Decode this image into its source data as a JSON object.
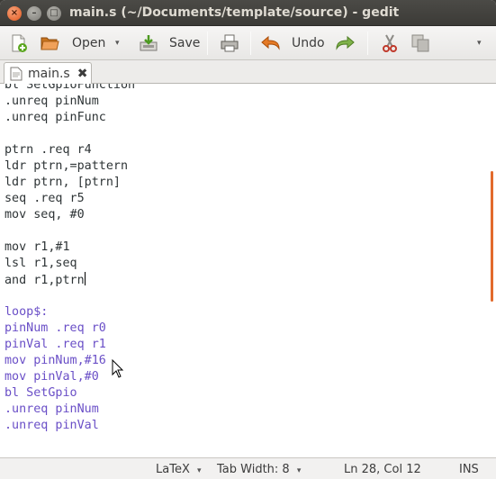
{
  "window": {
    "title": "main.s (~/Documents/template/source) - gedit",
    "close_glyph": "×",
    "min_glyph": "–",
    "max_glyph": "□"
  },
  "toolbar": {
    "new_icon": "new-document-icon",
    "open_label": "Open",
    "save_label": "Save",
    "print_icon": "print-icon",
    "undo_label": "Undo",
    "redo_icon": "redo-icon",
    "cut_icon": "cut-icon",
    "copy_icon": "copy-icon",
    "dropdown_glyph": "▾"
  },
  "tab": {
    "label": "main.s",
    "close_glyph": "✖"
  },
  "editor": {
    "lines": [
      {
        "text": "bl SetGpioFunction",
        "color": "black"
      },
      {
        "text": ".unreq pinNum",
        "color": "black"
      },
      {
        "text": ".unreq pinFunc",
        "color": "black"
      },
      {
        "text": "",
        "color": "black"
      },
      {
        "text": "ptrn .req r4",
        "color": "black"
      },
      {
        "text": "ldr ptrn,=pattern",
        "color": "black"
      },
      {
        "text": "ldr ptrn, [ptrn]",
        "color": "black"
      },
      {
        "text": "seq .req r5",
        "color": "black"
      },
      {
        "text": "mov seq, #0",
        "color": "black"
      },
      {
        "text": "",
        "color": "black"
      },
      {
        "text": "mov r1,#1",
        "color": "black"
      },
      {
        "text": "lsl r1,seq",
        "color": "black"
      },
      {
        "text": "and r1,ptrn",
        "color": "black"
      },
      {
        "text": "",
        "color": "black"
      },
      {
        "text": "loop$:",
        "color": "purple"
      },
      {
        "text": "pinNum .req r0",
        "color": "purple"
      },
      {
        "text": "pinVal .req r1",
        "color": "purple"
      },
      {
        "text": "mov pinNum,#16",
        "color": "purple"
      },
      {
        "text": "mov pinVal,#0",
        "color": "purple"
      },
      {
        "text": "bl SetGpio",
        "color": "purple"
      },
      {
        "text": ".unreq pinNum",
        "color": "purple"
      },
      {
        "text": ".unreq pinVal",
        "color": "purple"
      }
    ],
    "caret_line_index": 12
  },
  "statusbar": {
    "language": "LaTeX",
    "tab_width": "Tab Width:  8",
    "position": "Ln 28, Col 12",
    "mode": "INS",
    "dropdown_glyph": "▾"
  },
  "colors": {
    "title_bg": "#3c3b37",
    "close_button": "#e2571d",
    "code_default": "#2e3436",
    "code_highlight": "#6a4fc7",
    "scroll_indicator": "#e26a2c"
  }
}
